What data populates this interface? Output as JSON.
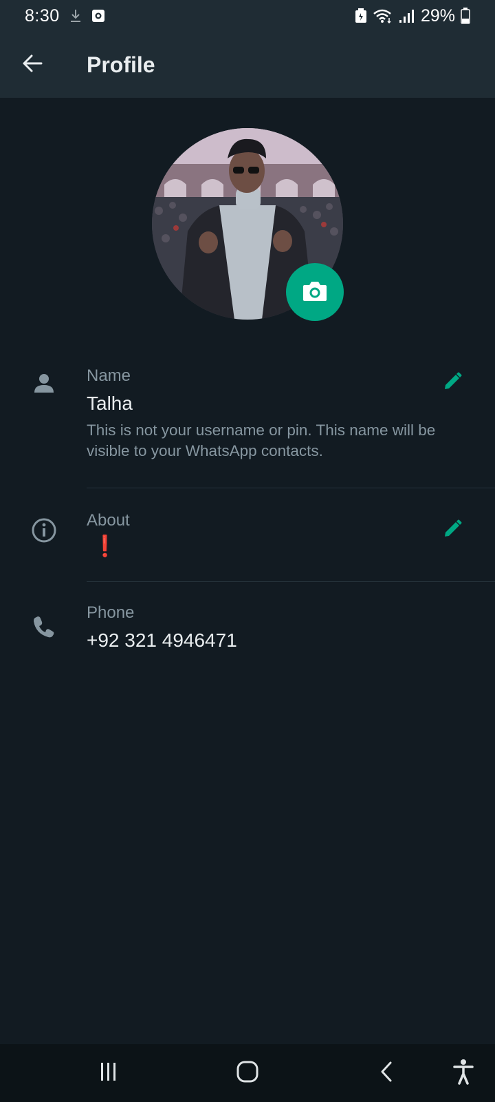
{
  "status_bar": {
    "time": "8:30",
    "battery": "29%",
    "icons": [
      "download-icon",
      "screen-record-icon",
      "battery-saver-icon",
      "wifi-icon",
      "signal-icon",
      "battery-icon"
    ]
  },
  "app_bar": {
    "title": "Profile",
    "back_icon": "arrow-left-icon"
  },
  "profile": {
    "camera_icon": "camera-icon",
    "name": {
      "label": "Name",
      "value": "Talha",
      "hint": "This is not your username or pin. This name will be visible to your WhatsApp contacts.",
      "icon": "person-icon",
      "edit_icon": "pencil-icon"
    },
    "about": {
      "label": "About",
      "value": "❗",
      "icon": "info-icon",
      "edit_icon": "pencil-icon"
    },
    "phone": {
      "label": "Phone",
      "value": "+92 321 4946471",
      "icon": "phone-icon"
    }
  },
  "nav_bar": {
    "buttons": [
      "recents-icon",
      "home-icon",
      "back-icon",
      "accessibility-icon"
    ]
  },
  "colors": {
    "background": "#121b22",
    "app_bar": "#1f2c34",
    "accent": "#00a884",
    "secondary_text": "#8696a0",
    "primary_text": "#e9edef"
  }
}
